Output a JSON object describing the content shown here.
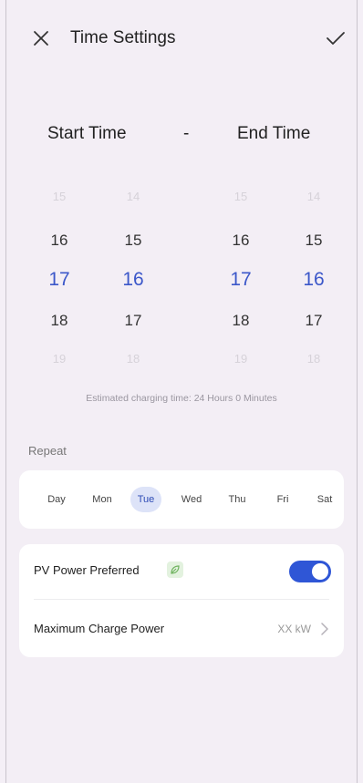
{
  "header": {
    "title": "Time Settings",
    "close_icon": "close-icon",
    "confirm_icon": "check-icon"
  },
  "range": {
    "start_label": "Start Time",
    "separator": "-",
    "end_label": "End Time"
  },
  "pickers": [
    {
      "name": "start-hour-picker",
      "values": [
        "15",
        "16",
        "17",
        "18",
        "19"
      ],
      "selected": "17"
    },
    {
      "name": "start-minute-picker",
      "values": [
        "14",
        "15",
        "16",
        "17",
        "18"
      ],
      "selected": "16"
    },
    {
      "name": "end-hour-picker",
      "values": [
        "15",
        "16",
        "17",
        "18",
        "19"
      ],
      "selected": "17"
    },
    {
      "name": "end-minute-picker",
      "values": [
        "14",
        "15",
        "16",
        "17",
        "18"
      ],
      "selected": "16"
    }
  ],
  "estimate_text": "Estimated charging time: 24 Hours 0 Minutes",
  "repeat": {
    "label": "Repeat",
    "days": [
      {
        "label": "Day",
        "selected": false
      },
      {
        "label": "Mon",
        "selected": false
      },
      {
        "label": "Tue",
        "selected": true
      },
      {
        "label": "Wed",
        "selected": false
      },
      {
        "label": "Thu",
        "selected": false
      },
      {
        "label": "Fri",
        "selected": false
      },
      {
        "label": "Sat",
        "selected": false
      }
    ]
  },
  "settings": {
    "pv_label": "PV Power Preferred",
    "pv_icon": "leaf-icon",
    "pv_enabled": true,
    "max_power_label": "Maximum Charge Power",
    "max_power_value": "XX kW"
  },
  "colors": {
    "accent": "#3b57c9",
    "toggle_on": "#2f56d6",
    "selected_day_bg": "#dde3f8",
    "background": "#f3eef5"
  }
}
